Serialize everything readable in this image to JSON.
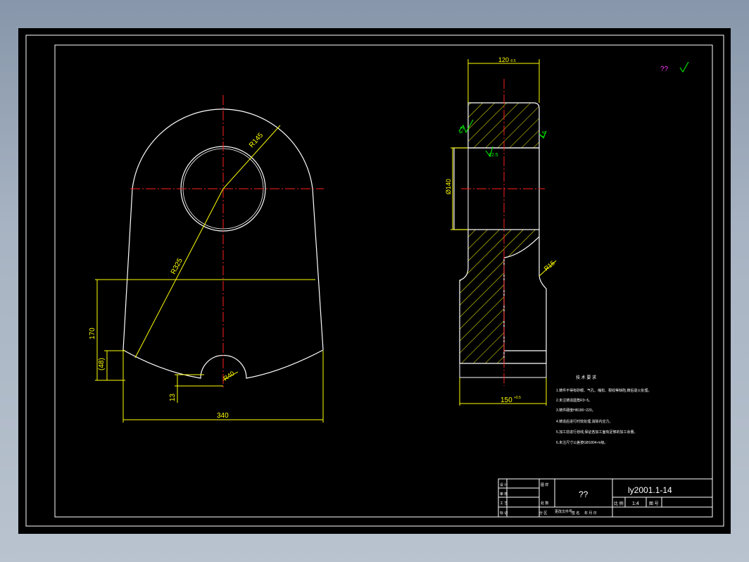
{
  "drawing": {
    "mark_top_right": "??",
    "front_view": {
      "dim_radius_hole": "R145",
      "dim_radius_outer": "R325",
      "dim_height": "170",
      "dim_small": "(48)",
      "dim_notch_radius": "R40",
      "dim_notch_depth": "13",
      "dim_width": "340"
    },
    "side_view": {
      "dim_top_width": "120",
      "dim_top_tol": "-0.5",
      "dim_bore": "Ø140",
      "dim_fillet": "R15",
      "dim_bottom_width": "150",
      "dim_bottom_tol": "+0.5",
      "roughness_left": "6.3",
      "roughness_right": "1.6",
      "roughness_bore": "12.5"
    },
    "notes": {
      "title": "技 术 要 求",
      "lines": [
        "1.铸件不得有砂眼、气孔、缩松、裂纹等缺陷,铸后退火处理。",
        "2.未注铸造圆角R3~5。",
        "3.铸件硬度HB180~220。",
        "4.铸造后进行时效处理,消除内应力。",
        "5.加工前进行划线,保证各加工面有足够的加工余量。",
        "6.未注尺寸公差按GB1804-m级。"
      ]
    },
    "title_block": {
      "drawing_number": "ly2001.1-14",
      "part_name": "??",
      "scale_label": "比 例",
      "scale_value": "1:4",
      "sheet_label": "图 号",
      "row_labels": [
        "设 计",
        "审 核",
        "工 艺",
        "标 记"
      ],
      "cell_labels": [
        "图 样",
        "处 数",
        "分 区",
        "更改文件号",
        "签 名",
        "年 月 日"
      ]
    }
  }
}
